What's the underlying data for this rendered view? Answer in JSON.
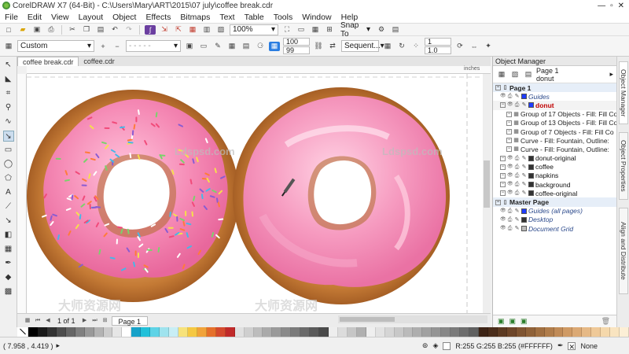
{
  "app": {
    "title": "CorelDRAW X7 (64-Bit) - C:\\Users\\Mary\\ART\\2015\\07 july\\coffee break.cdr",
    "window_controls": [
      "—",
      "▫",
      "✕"
    ]
  },
  "menu": [
    "File",
    "Edit",
    "View",
    "Layout",
    "Object",
    "Effects",
    "Bitmaps",
    "Text",
    "Table",
    "Tools",
    "Window",
    "Help"
  ],
  "toolbar": {
    "zoom_value": "100%",
    "snap_to_label": "Snap To"
  },
  "propbar": {
    "preset_value": "Custom",
    "size1": "100",
    "size2": "99",
    "sequence_value": "Sequent...",
    "outline_value1": "1",
    "outline_value2": "1.0"
  },
  "doc_tabs": [
    "coffee break.cdr",
    "coffee.cdr"
  ],
  "ruler": {
    "units": "inches"
  },
  "page_nav": {
    "count_text": "1 of 1",
    "page_tab": "Page 1"
  },
  "watermarks": [
    "Ldspsd.com",
    "Ldspsd.com",
    "大师资源网",
    "大师资源网"
  ],
  "status": {
    "coords": "( 7.958 , 4.419 )",
    "color_readout": "R:255 G:255 B:255 (#FFFFFF)",
    "outline_none": "None"
  },
  "object_manager": {
    "header": "Object Manager",
    "context_page": "Page 1",
    "context_layer": "donut",
    "rows": [
      {
        "label": "Page 1",
        "type": "section"
      },
      {
        "label": "Guides",
        "type": "guides",
        "color": "#1e3cff"
      },
      {
        "label": "donut",
        "type": "red",
        "color": "#1e3cff"
      },
      {
        "label": "Group of 17 Objects - Fill: Fill Co",
        "type": "object"
      },
      {
        "label": "Group of 13 Objects - Fill: Fill Co",
        "type": "object"
      },
      {
        "label": "Group of 7 Objects - Fill: Fill Co",
        "type": "object"
      },
      {
        "label": "Curve - Fill: Fountain, Outline:",
        "type": "object"
      },
      {
        "label": "Curve - Fill: Fountain, Outline:",
        "type": "object"
      },
      {
        "label": "donut-original",
        "type": "layer",
        "color": "#333333"
      },
      {
        "label": "coffee",
        "type": "layer",
        "color": "#333333"
      },
      {
        "label": "napkins",
        "type": "layer",
        "color": "#333333"
      },
      {
        "label": "background",
        "type": "layer",
        "color": "#333333"
      },
      {
        "label": "coffee-original",
        "type": "layer",
        "color": "#333333"
      },
      {
        "label": "Master Page",
        "type": "section"
      },
      {
        "label": "Guides (all pages)",
        "type": "blue",
        "color": "#1e3cff"
      },
      {
        "label": "Desktop",
        "type": "blue",
        "color": "#333333"
      },
      {
        "label": "Document Grid",
        "type": "blue",
        "color": "#bbbbbb"
      }
    ]
  },
  "docker_tabs": [
    "Object Manager",
    "Object Properties",
    "Align and Distribute"
  ],
  "palette": [
    "#000000",
    "#1a1a1a",
    "#333333",
    "#4d4d4d",
    "#666666",
    "#808080",
    "#999999",
    "#b3b3b3",
    "#cccccc",
    "#e6e6e6",
    "#ffffff",
    "#17a2c9",
    "#21c0d9",
    "#5ed3e6",
    "#9fe3ee",
    "#c8eef5",
    "#f7e27a",
    "#f5c842",
    "#f1a33a",
    "#e5702b",
    "#d44a2e",
    "#c02a2a",
    "#e0e0e0",
    "#cfcfcf",
    "#bdbdbd",
    "#aaaaaa",
    "#9a9a9a",
    "#8a8a8a",
    "#7a7a7a",
    "#6a6a6a",
    "#5a5a5a",
    "#4a4a4a",
    "#eeeeee",
    "#dcdcdc",
    "#c6c6c6",
    "#b0b0b0",
    "#efefef",
    "#e2e2e2",
    "#d5d5d5",
    "#c8c8c8",
    "#bbbbbb",
    "#aeaeae",
    "#a1a1a1",
    "#949494",
    "#878787",
    "#7a7a7a",
    "#6d6d6d",
    "#606060",
    "#3d2416",
    "#4a2d1b",
    "#5c3a22",
    "#6e4629",
    "#7f5431",
    "#8f6138",
    "#a06f41",
    "#b07d4b",
    "#c08b57",
    "#cf9a64",
    "#dba974",
    "#e6b986",
    "#efc998",
    "#f5d8ab",
    "#f9e4c0",
    "#fcefd6"
  ]
}
